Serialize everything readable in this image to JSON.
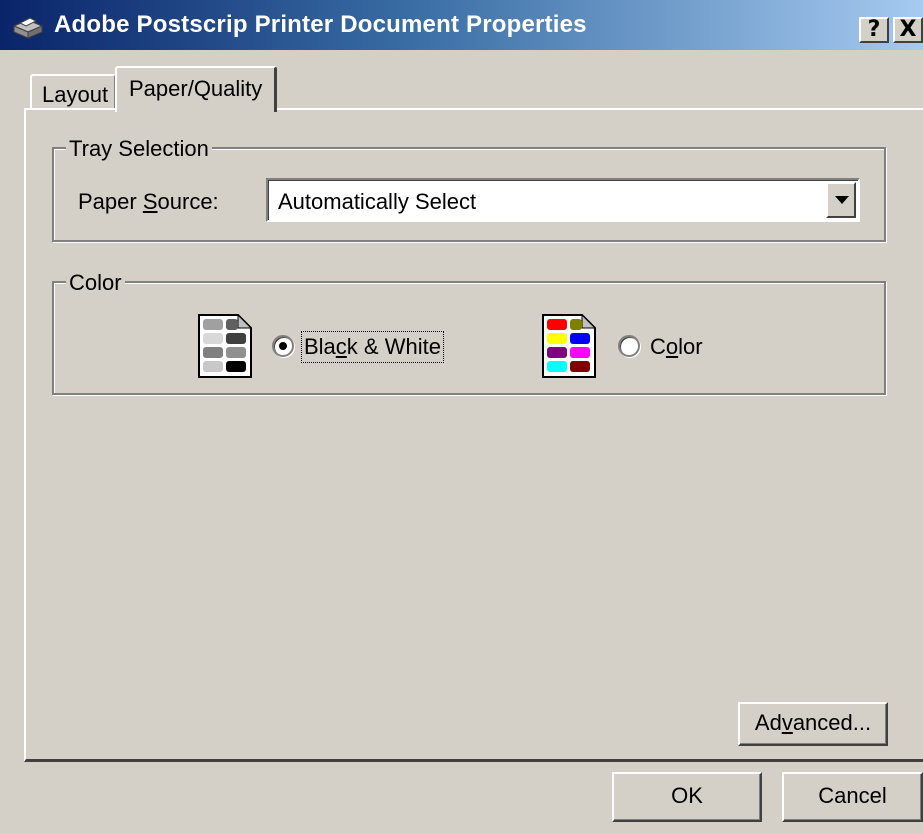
{
  "window": {
    "title": "Adobe Postscrip Printer Document Properties",
    "help_label": "?",
    "close_label": "X",
    "title_gradient": [
      "#0a246a",
      "#a6caf0"
    ]
  },
  "tabs": [
    {
      "label": "Layout",
      "selected": false
    },
    {
      "label": "Paper/Quality",
      "selected": true
    }
  ],
  "tray_selection": {
    "title": "Tray Selection",
    "paper_source_label": "Paper ",
    "paper_source_underline": "S",
    "paper_source_rest": "ource:",
    "paper_source_value": "Automatically Select"
  },
  "color": {
    "title": "Color",
    "bw_label_pre": "Bla",
    "bw_label_underline": "c",
    "bw_label_post": "k & White",
    "bw_selected": true,
    "color_label_pre": "C",
    "color_label_underline": "o",
    "color_label_post": "lor",
    "color_selected": false,
    "bw_icon": "grayscale-page-icon",
    "color_icon": "color-page-icon"
  },
  "buttons": {
    "advanced_pre": "Ad",
    "advanced_underline": "v",
    "advanced_post": "anced...",
    "ok": "OK",
    "cancel": "Cancel"
  }
}
